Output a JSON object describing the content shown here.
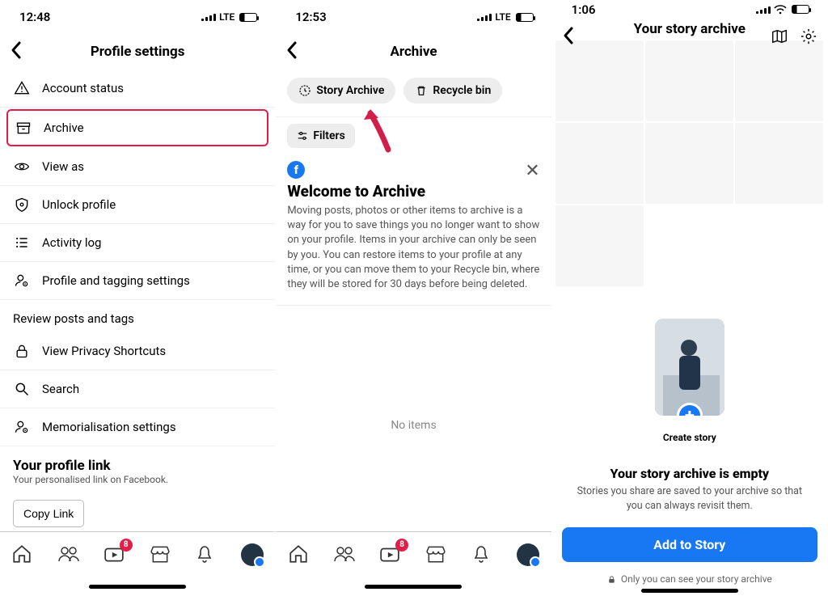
{
  "screens": {
    "settings": {
      "status": {
        "time": "12:48",
        "carrier": "LTE"
      },
      "title": "Profile settings",
      "items": [
        {
          "label": "Account status"
        },
        {
          "label": "Archive"
        },
        {
          "label": "View as"
        },
        {
          "label": "Unlock profile"
        },
        {
          "label": "Activity log"
        },
        {
          "label": "Profile and tagging settings"
        }
      ],
      "section_label": "Review posts and tags",
      "items2": [
        {
          "label": "View Privacy Shortcuts"
        },
        {
          "label": "Search"
        },
        {
          "label": "Memorialisation settings"
        }
      ],
      "profile_link": {
        "title": "Your profile link",
        "subtitle": "Your personalised link on Facebook."
      },
      "copy_button": "Copy Link",
      "tabbar": {
        "video_badge": "8"
      }
    },
    "archive": {
      "status": {
        "time": "12:53",
        "carrier": "LTE"
      },
      "title": "Archive",
      "pills": {
        "story": "Story Archive",
        "recycle": "Recycle bin"
      },
      "filters": "Filters",
      "welcome": {
        "title": "Welcome to Archive",
        "body": "Moving posts, photos or other items to archive is a way for you to save things you no longer want to show on your profile. Items in your archive can only be seen by you. You can restore items to your profile at any time, or you can move them to your Recycle bin, where they will be stored for 30 days before being deleted."
      },
      "no_items": "No items",
      "tabbar": {
        "video_badge": "8"
      }
    },
    "story_archive": {
      "status": {
        "time": "1:06"
      },
      "title": "Your story archive",
      "create_label": "Create story",
      "empty_title": "Your story archive is empty",
      "empty_body": "Stories you share are saved to your archive so that you can always revisit them.",
      "add_button": "Add to Story",
      "private_note": "Only you can see your story archive"
    }
  }
}
